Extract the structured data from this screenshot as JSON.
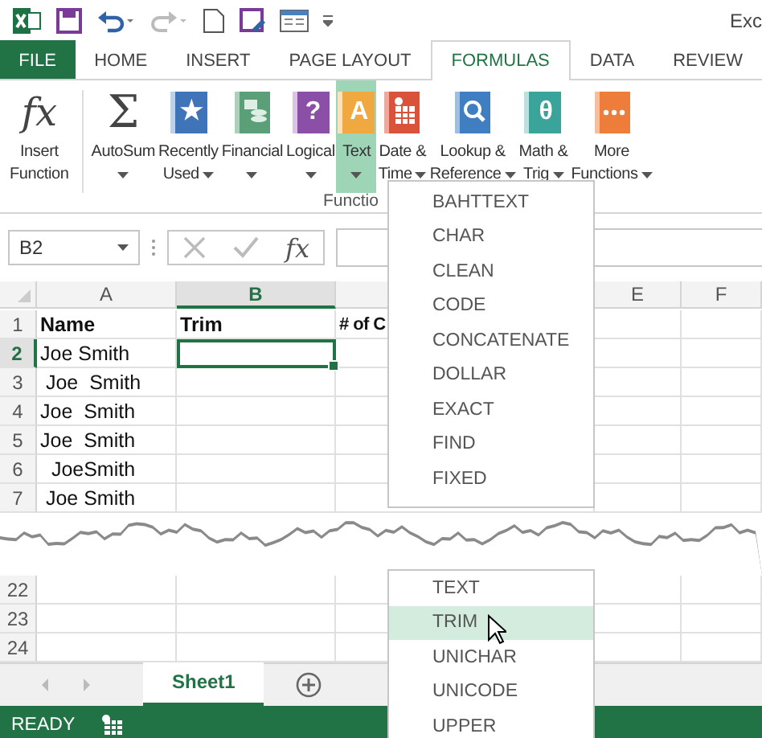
{
  "title": "Exc",
  "tabs": [
    {
      "label": "FILE",
      "kind": "file",
      "selected": false
    },
    {
      "label": "HOME",
      "kind": "tab",
      "selected": false
    },
    {
      "label": "INSERT",
      "kind": "tab",
      "selected": false
    },
    {
      "label": "PAGE LAYOUT",
      "kind": "tab",
      "selected": false
    },
    {
      "label": "FORMULAS",
      "kind": "tab",
      "selected": true
    },
    {
      "label": "DATA",
      "kind": "tab",
      "selected": false
    },
    {
      "label": "REVIEW",
      "kind": "tab",
      "selected": false
    }
  ],
  "ribbon": {
    "buttons": [
      {
        "lines": [
          "Insert",
          "Function"
        ],
        "dropdown": false,
        "kind": "symbol",
        "glyph": "fx",
        "selected": false
      },
      {
        "lines": [
          "AutoSum"
        ],
        "dropdown": true,
        "kind": "symbol",
        "glyph": "Σ",
        "selected": false
      },
      {
        "lines": [
          "Recently",
          "Used"
        ],
        "dropdown": true,
        "kind": "book",
        "glyph": "★",
        "color": "#3f74b8",
        "selected": false
      },
      {
        "lines": [
          "Financial"
        ],
        "dropdown": true,
        "kind": "coins",
        "color": "#5a9f78",
        "selected": false
      },
      {
        "lines": [
          "Logical"
        ],
        "dropdown": true,
        "kind": "book",
        "glyph": "?",
        "color": "#8c4fa8",
        "selected": false
      },
      {
        "lines": [
          "Text"
        ],
        "dropdown": true,
        "kind": "book",
        "glyph": "A",
        "color": "#f0a840",
        "selected": true
      },
      {
        "lines": [
          "Date &",
          "Time"
        ],
        "dropdown": true,
        "kind": "calendar",
        "color": "#d9533a",
        "selected": false
      },
      {
        "lines": [
          "Lookup &",
          "Reference"
        ],
        "dropdown": true,
        "kind": "search",
        "color": "#3f7fc1",
        "selected": false
      },
      {
        "lines": [
          "Math &",
          "Trig"
        ],
        "dropdown": true,
        "kind": "book",
        "glyph": "θ",
        "color": "#3aa39a",
        "selected": false
      },
      {
        "lines": [
          "More",
          "Functions"
        ],
        "dropdown": true,
        "kind": "dots",
        "color": "#ee7d3b",
        "selected": false
      }
    ],
    "group_label": "Functio"
  },
  "formula_bar": {
    "name_box": "B2",
    "fx": "fx"
  },
  "columns": [
    {
      "label": "A",
      "selected": false
    },
    {
      "label": "B",
      "selected": true
    },
    {
      "label": "E",
      "selected": false
    },
    {
      "label": "F",
      "selected": false
    }
  ],
  "rows": [
    {
      "number": "1",
      "bold": true,
      "selected": false,
      "cells": [
        "Name",
        "Trim",
        "# of C"
      ]
    },
    {
      "number": "2",
      "bold": false,
      "selected": true,
      "cells": [
        "Joe Smith"
      ]
    },
    {
      "number": "3",
      "bold": false,
      "selected": false,
      "cells": [
        " Joe  Smith"
      ]
    },
    {
      "number": "4",
      "bold": false,
      "selected": false,
      "cells": [
        "Joe  Smith"
      ]
    },
    {
      "number": "5",
      "bold": false,
      "selected": false,
      "cells": [
        "Joe  Smith"
      ]
    },
    {
      "number": "6",
      "bold": false,
      "selected": false,
      "cells": [
        "  JoeSmith"
      ]
    },
    {
      "number": "7",
      "bold": false,
      "selected": false,
      "cells": [
        " Joe Smith"
      ]
    }
  ],
  "rows_after_tear": [
    {
      "number": "22"
    },
    {
      "number": "23"
    },
    {
      "number": "24"
    }
  ],
  "sheet_tabs": [
    {
      "label": "Sheet1",
      "selected": true
    }
  ],
  "status": "READY",
  "menu": {
    "items": [
      {
        "label": "BAHTTEXT",
        "selected": false
      },
      {
        "label": "CHAR",
        "selected": false
      },
      {
        "label": "CLEAN",
        "selected": false
      },
      {
        "label": "CODE",
        "selected": false
      },
      {
        "label": "CONCATENATE",
        "selected": false
      },
      {
        "label": "DOLLAR",
        "selected": false
      },
      {
        "label": "EXACT",
        "selected": false
      },
      {
        "label": "FIND",
        "selected": false
      },
      {
        "label": "FIXED",
        "selected": false
      }
    ],
    "items_after_tear": [
      {
        "label": "TEXT",
        "selected": false
      },
      {
        "label": "TRIM",
        "selected": true
      },
      {
        "label": "UNICHAR",
        "selected": false
      },
      {
        "label": "UNICODE",
        "selected": false
      },
      {
        "label": "UPPER",
        "selected": false
      }
    ]
  }
}
